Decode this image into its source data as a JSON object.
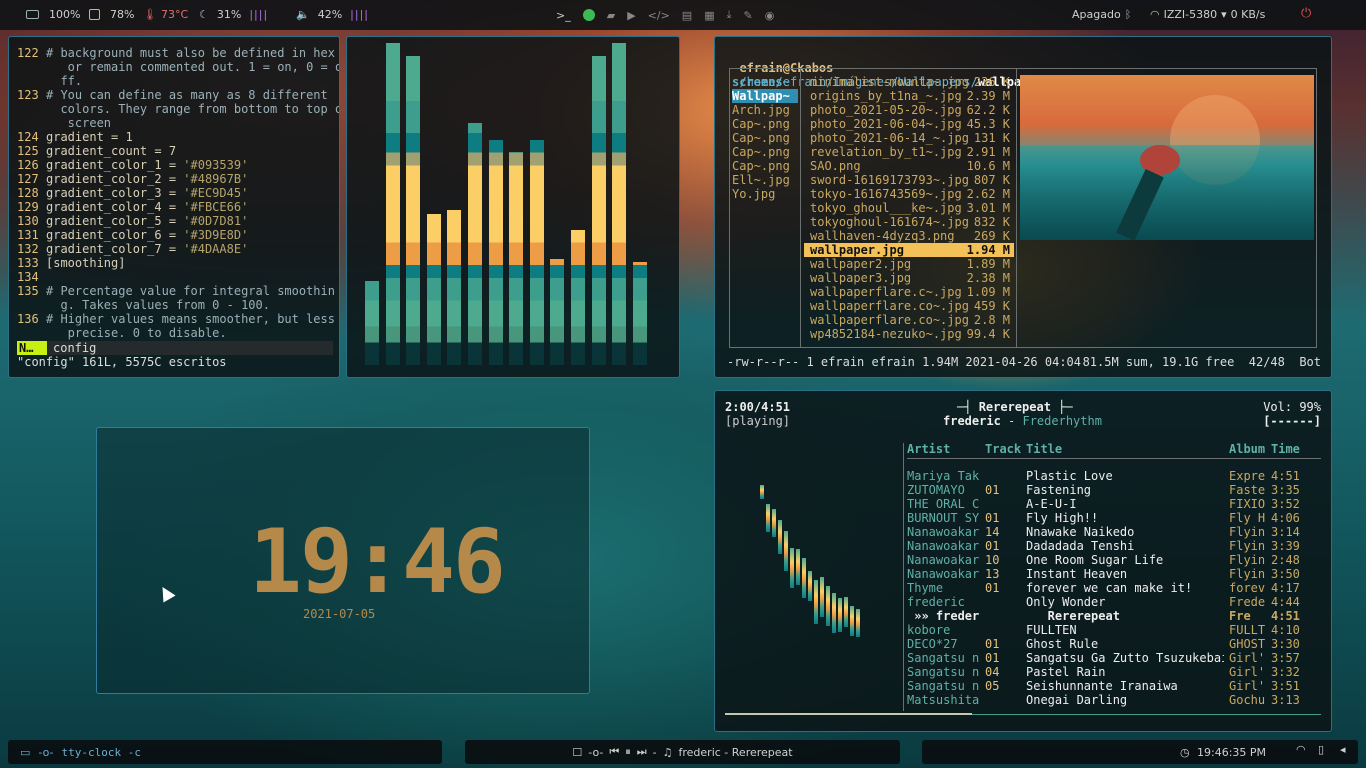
{
  "topbar": {
    "battery": "100%",
    "cpu": "78%",
    "temp": "73°C",
    "mem": "31%",
    "mem_bars": "||||",
    "vol": "42%",
    "vol_bars": "||||",
    "wifi_status": "Apagado",
    "network": "IZZI-5380",
    "speed": "0 KB/s",
    "icons": [
      "battery-icon",
      "cpu-icon",
      "thermometer-icon",
      "moon-icon",
      "volume-icon",
      "terminal-icon",
      "spotify-icon",
      "folder-icon",
      "play-icon",
      "code-icon",
      "file-icon",
      "document-icon",
      "download-icon",
      "wrench-icon",
      "gamepad-icon",
      "bluetooth-icon",
      "wifi-icon",
      "power-icon"
    ]
  },
  "editor": {
    "lines": [
      {
        "n": "122",
        "t": "# background must also be defined in hex",
        "c": "cm"
      },
      {
        "n": "",
        "t": "   or remain commented out. 1 = on, 0 = o",
        "c": "cm"
      },
      {
        "n": "",
        "t": "  ff.",
        "c": "cm"
      },
      {
        "n": "123",
        "t": "# You can define as many as 8 different",
        "c": "cm"
      },
      {
        "n": "",
        "t": "  colors. They range from bottom to top of",
        "c": "cm"
      },
      {
        "n": "",
        "t": "   screen",
        "c": "cm"
      },
      {
        "n": "124",
        "t": "gradient = 1",
        "c": "eq"
      },
      {
        "n": "125",
        "t": "gradient_count = 7",
        "c": "eq"
      },
      {
        "n": "126",
        "t": "gradient_color_1 = '#093539'",
        "c": "eq"
      },
      {
        "n": "127",
        "t": "gradient_color_2 = '#48967B'",
        "c": "eq"
      },
      {
        "n": "128",
        "t": "gradient_color_3 = '#EC9D45'",
        "c": "eq"
      },
      {
        "n": "129",
        "t": "gradient_color_4 = '#FBCE66'",
        "c": "eq"
      },
      {
        "n": "130",
        "t": "gradient_color_5 = '#0D7D81'",
        "c": "eq"
      },
      {
        "n": "131",
        "t": "gradient_color_6 = '#3D9E8D'",
        "c": "eq"
      },
      {
        "n": "132",
        "t": "gradient_color_7 = '#4DAA8E'",
        "c": "eq"
      },
      {
        "n": "133",
        "t": "[smoothing]",
        "c": "eq"
      },
      {
        "n": "134",
        "t": "",
        "c": "eq"
      },
      {
        "n": "135",
        "t": "# Percentage value for integral smoothin",
        "c": "cm"
      },
      {
        "n": "",
        "t": "  g. Takes values from 0 - 100.",
        "c": "cm"
      },
      {
        "n": "136",
        "t": "# Higher values means smoother, but less",
        "c": "cm"
      },
      {
        "n": "",
        "t": "   precise. 0 to disable.",
        "c": "cm"
      }
    ],
    "mode": "N…",
    "filename": "config",
    "message": "\"config\" 161L, 5575C escritos"
  },
  "visualizer": {
    "levels": [
      0.26,
      1.0,
      0.96,
      0.47,
      0.48,
      0.75,
      0.7,
      0.66,
      0.7,
      0.33,
      0.42,
      0.96,
      1.0,
      0.32
    ],
    "colors": [
      "#093539",
      "#48967B",
      "#EC9D45",
      "#FBCE66",
      "#0D7D81",
      "#3D9E8D",
      "#4DAA8E"
    ]
  },
  "ranger": {
    "user": "efrain@Ckabos",
    "path": "/home/efrain/Imágenes/Wallpapers/",
    "file": "wallpaper.jpg",
    "left": [
      {
        "t": "screens~",
        "sel": false,
        "dir": true
      },
      {
        "t": "Wallpap~",
        "sel": true,
        "dir": true
      },
      {
        "t": "Arch.jpg"
      },
      {
        "t": "Cap~.png"
      },
      {
        "t": "Cap~.png"
      },
      {
        "t": "Cap~.png"
      },
      {
        "t": "Cap~.png"
      },
      {
        "t": "Ell~.jpg"
      },
      {
        "t": "Yo.jpg"
      }
    ],
    "files": [
      {
        "n": "minimalist-mounta~.jpg",
        "s": "236 K"
      },
      {
        "n": "origins_by_t1na_~.jpg",
        "s": "2.39 M"
      },
      {
        "n": "photo_2021-05-20~.jpg",
        "s": "62.2 K"
      },
      {
        "n": "photo_2021-06-04~.jpg",
        "s": "45.3 K"
      },
      {
        "n": "photo_2021-06-14_~.jpg",
        "s": "131 K"
      },
      {
        "n": "revelation_by_t1~.jpg",
        "s": "2.91 M"
      },
      {
        "n": "SAO.png",
        "s": "10.6 M"
      },
      {
        "n": "sword-16169173793~.jpg",
        "s": "807 K"
      },
      {
        "n": "tokyo-1616743569~.jpg",
        "s": "2.62 M"
      },
      {
        "n": "tokyo_ghoul___ke~.jpg",
        "s": "3.01 M"
      },
      {
        "n": "tokyoghoul-161674~.jpg",
        "s": "832 K"
      },
      {
        "n": "wallhaven-4dyzq3.png",
        "s": "269 K"
      },
      {
        "n": "wallpaper.jpg",
        "s": "1.94 M",
        "sel": true
      },
      {
        "n": "wallpaper2.jpg",
        "s": "1.89 M"
      },
      {
        "n": "wallpaper3.jpg",
        "s": "2.38 M"
      },
      {
        "n": "wallpaperflare.c~.jpg",
        "s": "1.09 M"
      },
      {
        "n": "wallpaperflare.co~.jpg",
        "s": "459 K"
      },
      {
        "n": "wallpaperflare.co~.jpg",
        "s": "2.8 M"
      },
      {
        "n": "wp4852184-nezuko~.jpg",
        "s": "99.4 K"
      }
    ],
    "status_left": "-rw-r--r-- 1 efrain efrain 1.94M 2021-04-26 04:04",
    "status_right": "81.5M sum, 19.1G free  42/48  Bot"
  },
  "clock": {
    "time": "19:46",
    "date": "2021-07-05"
  },
  "ncmpcpp": {
    "elapsed": "2:00/4:51",
    "state": "[playing]",
    "title": "Rererepeat",
    "artist": "frederic",
    "album": "Frederhythm",
    "volume": "Vol: 99%",
    "flags": "[------]",
    "headers": {
      "artist": "Artist",
      "track": "Track",
      "title": "Title",
      "album": "Album",
      "time": "Time"
    },
    "rows": [
      {
        "a": "Mariya Tak",
        "tr": "",
        "ti": "Plastic Love",
        "al": "Expre",
        "tm": "4:51"
      },
      {
        "a": "ZUTOMAYO",
        "tr": "01",
        "ti": "Fastening",
        "al": "Faste",
        "tm": "3:35"
      },
      {
        "a": "THE ORAL C",
        "tr": "",
        "ti": "A-E-U-I",
        "al": "FIXIO",
        "tm": "3:52"
      },
      {
        "a": "BURNOUT SY",
        "tr": "01",
        "ti": "Fly High!!",
        "al": "Fly H",
        "tm": "4:06"
      },
      {
        "a": "Nanawoakar",
        "tr": "14",
        "ti": "Nnawake Naikedo",
        "al": "Flyin",
        "tm": "3:14"
      },
      {
        "a": "Nanawoakar",
        "tr": "01",
        "ti": "Dadadada Tenshi",
        "al": "Flyin",
        "tm": "3:39"
      },
      {
        "a": "Nanawoakar",
        "tr": "10",
        "ti": "One Room Sugar Life",
        "al": "Flyin",
        "tm": "2:48"
      },
      {
        "a": "Nanawoakar",
        "tr": "13",
        "ti": "Instant Heaven",
        "al": "Flyin",
        "tm": "3:50"
      },
      {
        "a": "Thyme",
        "tr": "01",
        "ti": "forever we can make it!",
        "al": "forev",
        "tm": "4:17"
      },
      {
        "a": "frederic",
        "tr": "",
        "ti": "Only Wonder",
        "al": "Frede",
        "tm": "4:44"
      },
      {
        "a": " »» frederic",
        "tr": "",
        "ti": "   Rererepeat",
        "al": "Fre",
        "tm": "4:51",
        "cur": true
      },
      {
        "a": "kobore",
        "tr": "",
        "ti": "FULLTEN",
        "al": "FULLT",
        "tm": "4:10"
      },
      {
        "a": "DECO*27",
        "tr": "01",
        "ti": "Ghost Rule",
        "al": "GHOST",
        "tm": "3:30"
      },
      {
        "a": "Sangatsu n",
        "tr": "01",
        "ti": "Sangatsu Ga Zutto Tsuzukebai",
        "al": "Girl'",
        "tm": "3:57"
      },
      {
        "a": "Sangatsu n",
        "tr": "04",
        "ti": "Pastel Rain",
        "al": "Girl'",
        "tm": "3:32"
      },
      {
        "a": "Sangatsu n",
        "tr": "05",
        "ti": "Seishunnante Iranaiwa",
        "al": "Girl'",
        "tm": "3:51"
      },
      {
        "a": "Matsushita",
        "tr": "",
        "ti": "Onegai Darling",
        "al": "Gochu",
        "tm": "3:13"
      }
    ]
  },
  "bottombar": {
    "left": "tty-clock -c",
    "media": "frederic - Rererepeat",
    "time": "19:46:35 PM"
  }
}
